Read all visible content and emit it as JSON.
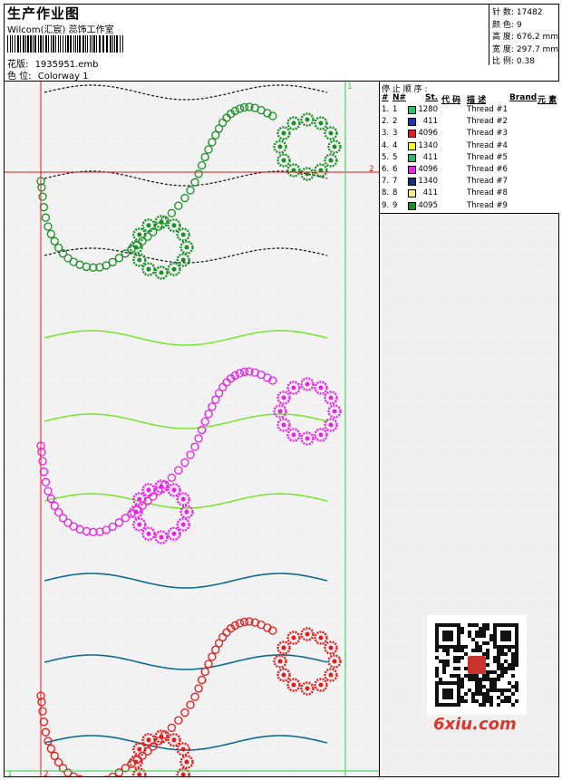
{
  "header": {
    "title": "生产作业图",
    "studio": "Wilcom(汇宸) 蕊饰工作室",
    "design_label": "花版:",
    "design_file": "1935951.emb",
    "colorway_label": "色 位:",
    "colorway": "Colorway 1"
  },
  "stats": [
    {
      "label": "针 数:",
      "value": "17482"
    },
    {
      "label": "颜 色:",
      "value": "9"
    },
    {
      "label": "高 度:",
      "value": "676.2 mm"
    },
    {
      "label": "宽 度:",
      "value": "297.7 mm"
    },
    {
      "label": "比 例:",
      "value": "0.38"
    }
  ],
  "canvas": {
    "marker_1": "1",
    "marker_2": "2"
  },
  "sequence": {
    "title": "停 止 顺 序 :",
    "columns": {
      "hash": "#",
      "n": "N#",
      "st": "St.",
      "code": "代 码",
      "desc": "描 述",
      "brand": "Brand",
      "element": "元 素"
    },
    "threads": [
      {
        "no": "1.",
        "n": "1",
        "color": "#22c66a",
        "code": "1280",
        "desc": "Thread #1"
      },
      {
        "no": "2.",
        "n": "2",
        "color": "#1e2fc8",
        "code": "411",
        "desc": "Thread #2"
      },
      {
        "no": "3.",
        "n": "3",
        "color": "#e81919",
        "code": "4096",
        "desc": "Thread #3"
      },
      {
        "no": "4.",
        "n": "4",
        "color": "#ffff1e",
        "code": "1340",
        "desc": "Thread #4"
      },
      {
        "no": "5.",
        "n": "5",
        "color": "#1ec35a",
        "code": "411",
        "desc": "Thread #5"
      },
      {
        "no": "6.",
        "n": "6",
        "color": "#ee1eee",
        "code": "4096",
        "desc": "Thread #6"
      },
      {
        "no": "7.",
        "n": "7",
        "color": "#142f86",
        "code": "1340",
        "desc": "Thread #7"
      },
      {
        "no": "8.",
        "n": "8",
        "color": "#f7ef8a",
        "code": "411",
        "desc": "Thread #8"
      },
      {
        "no": "9.",
        "n": "9",
        "color": "#1a8f26",
        "code": "4095",
        "desc": "Thread #9"
      }
    ]
  },
  "design_colors": {
    "motif_top": "#1a8f26",
    "motif_mid": "#ee1eee",
    "motif_bottom": "#e81919",
    "wave_top": "#111111",
    "wave_mid": "#6ee61e",
    "wave_bottom": "#0c6b8f",
    "guide_red": "#e81919",
    "guide_green": "#22d24a"
  },
  "watermark": "6xiu.com"
}
